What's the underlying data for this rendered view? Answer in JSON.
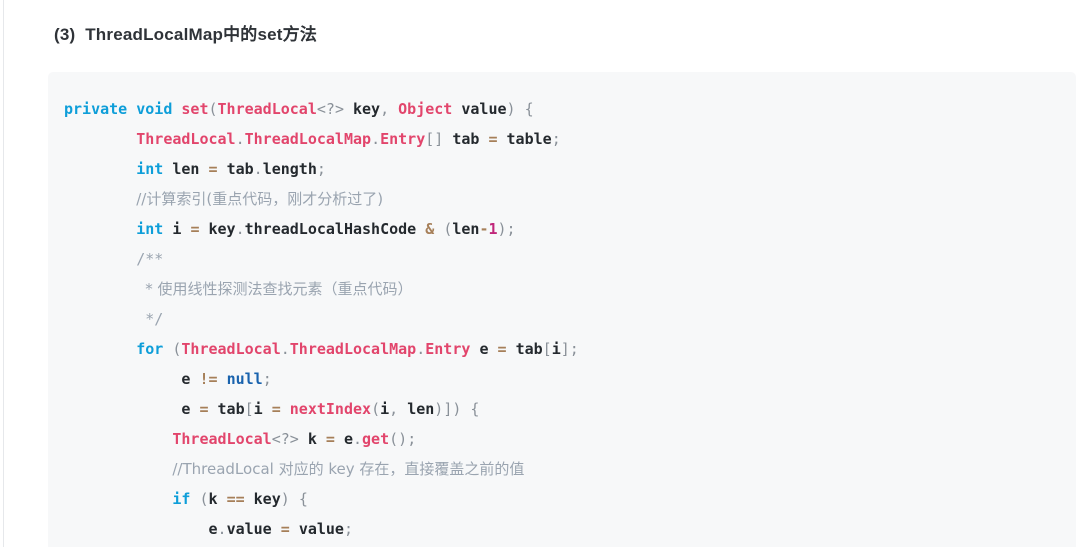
{
  "heading": {
    "text": "(3)  ThreadLocalMap中的set方法"
  },
  "code_block": {
    "language": "java",
    "background": "#f7f8f9",
    "lines": [
      "private void set(ThreadLocal<?> key, Object value) {",
      "        ThreadLocal.ThreadLocalMap.Entry[] tab = table;",
      "        int len = tab.length;",
      "        //计算索引(重点代码，刚才分析过了)",
      "        int i = key.threadLocalHashCode & (len-1);",
      "        /**",
      "         * 使用线性探测法查找元素（重点代码）",
      "         */",
      "        for (ThreadLocal.ThreadLocalMap.Entry e = tab[i];",
      "             e != null;",
      "             e = tab[i = nextIndex(i, len)]) {",
      "            ThreadLocal<?> k = e.get();",
      "            //ThreadLocal 对应的 key 存在，直接覆盖之前的值",
      "            if (k == key) {",
      "                e.value = value;"
    ],
    "tokens": {
      "keywords": [
        "private",
        "void",
        "int",
        "for",
        "if"
      ],
      "constants": [
        "null"
      ],
      "types": [
        "ThreadLocal",
        "ThreadLocalMap",
        "Entry",
        "Object"
      ],
      "functions": [
        "set",
        "nextIndex",
        "get"
      ],
      "identifiers": [
        "key",
        "value",
        "tab",
        "table",
        "len",
        "i",
        "e",
        "k",
        "length",
        "threadLocalHashCode"
      ],
      "operators": [
        "=",
        "!=",
        "==",
        "&",
        "-"
      ],
      "numbers": [
        "1"
      ],
      "comments": [
        "//计算索引(重点代码，刚才分析过了)",
        "/**",
        "* 使用线性探测法查找元素（重点代码）",
        "*/",
        "//ThreadLocal 对应的 key 存在，直接覆盖之前的值"
      ]
    },
    "colors": {
      "keyword": "#0e9ed9",
      "constant": "#1a63ae",
      "type": "#e2456c",
      "function": "#e2456c",
      "identifier": "#24292e",
      "operator": "#a67f59",
      "number": "#c0267a",
      "punctuation": "#8a9199",
      "comment": "#9aa4b0"
    }
  }
}
